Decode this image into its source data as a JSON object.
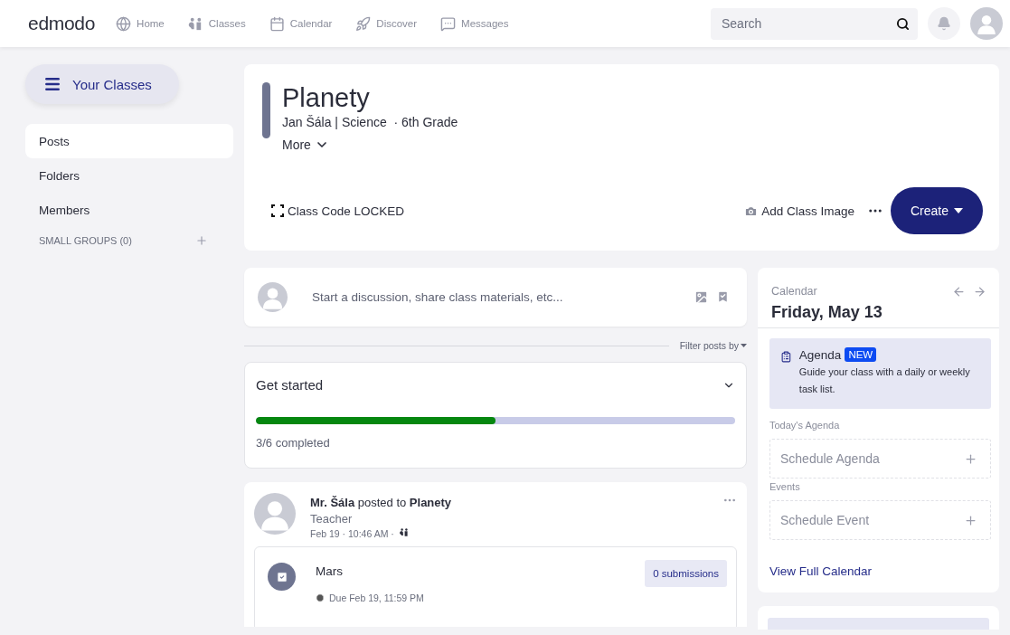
{
  "header": {
    "logo": "edmodo",
    "nav": [
      {
        "label": "Home"
      },
      {
        "label": "Classes"
      },
      {
        "label": "Calendar"
      },
      {
        "label": "Discover"
      },
      {
        "label": "Messages"
      }
    ],
    "search": {
      "placeholder": "Search"
    }
  },
  "sidebar": {
    "button": "Your Classes",
    "items": [
      {
        "label": "Posts",
        "selected": true
      },
      {
        "label": "Folders",
        "selected": false
      },
      {
        "label": "Members",
        "selected": false
      }
    ],
    "small_groups": "SMALL GROUPS (0)"
  },
  "class_card": {
    "title": "Planety",
    "subtitle": "Jan Šála | Science  · 6th Grade",
    "more": "More",
    "class_code": "Class Code LOCKED",
    "add_image": "Add Class Image",
    "create": "Create"
  },
  "composer": {
    "placeholder": "Start a discussion, share class materials, etc..."
  },
  "filter": "Filter posts by",
  "get_started": {
    "title": "Get started",
    "level": 0.5,
    "progress_text": "3/6 completed"
  },
  "post": {
    "headline": "**Mr. Šála** posted to **Planety**",
    "role": "Teacher",
    "time": "Feb 19 · 10:46 AM ·",
    "assignment": {
      "title": "Mars",
      "due": "Due Feb 19, 11:59 PM",
      "submissions": "0 submissions"
    }
  },
  "calendar": {
    "label": "Calendar",
    "date": "Friday, May 13",
    "agenda": {
      "title": "Agenda",
      "badge": "NEW",
      "text": "Guide your class with a daily or weekly task list."
    },
    "sections": [
      {
        "heading": "Today's Agenda",
        "action": "Schedule Agenda"
      },
      {
        "heading": "Events",
        "action": "Schedule Event"
      }
    ],
    "link": "View Full Calendar"
  }
}
